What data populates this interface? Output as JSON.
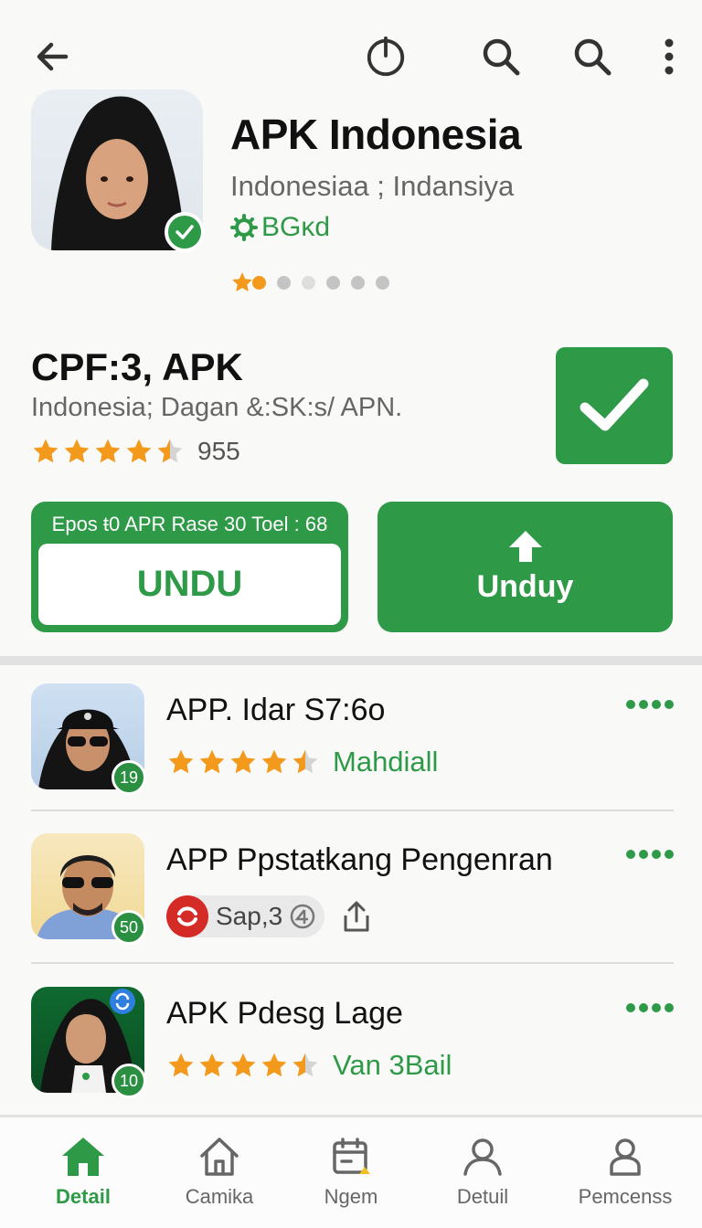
{
  "hero": {
    "title": "APK Indonesia",
    "subtitle": "Indonesiaa ; Indansiya",
    "tag": "BGĸd",
    "rating": 1,
    "rating_max": 6
  },
  "app": {
    "title": "CPF:3, APK",
    "subtitle": "Indonesia; Dagan &:SK:s/ APN.",
    "rating": 4.5,
    "rating_max": 5,
    "count": "955"
  },
  "actions": {
    "outline_meta": "Epos ŧ0 APR Rase 30 Toel : 68",
    "outline_label": "UNDU",
    "solid_label": "Unduy"
  },
  "list": [
    {
      "title": "APP. Idar S7:6o",
      "badge": "19",
      "rating": 4.5,
      "label": "Mahdiall"
    },
    {
      "title": "APP Ppstaŧkang Pengenran",
      "badge": "50",
      "chip": "Sap,3"
    },
    {
      "title": "APK Pdesg Lage",
      "badge": "10",
      "rating": 4.5,
      "label": "Van 3Bail"
    }
  ],
  "nav": [
    {
      "label": "Detail",
      "icon": "home-icon",
      "active": true
    },
    {
      "label": "Camika",
      "icon": "house-outline-icon",
      "active": false
    },
    {
      "label": "Ngem",
      "icon": "calendar-icon",
      "active": false
    },
    {
      "label": "Detuil",
      "icon": "user-icon",
      "active": false
    },
    {
      "label": "Pemcenss",
      "icon": "person-box-icon",
      "active": false
    }
  ],
  "colors": {
    "accent": "#2e9a48",
    "star": "#f39a1c",
    "background": "#f9f9f8"
  }
}
